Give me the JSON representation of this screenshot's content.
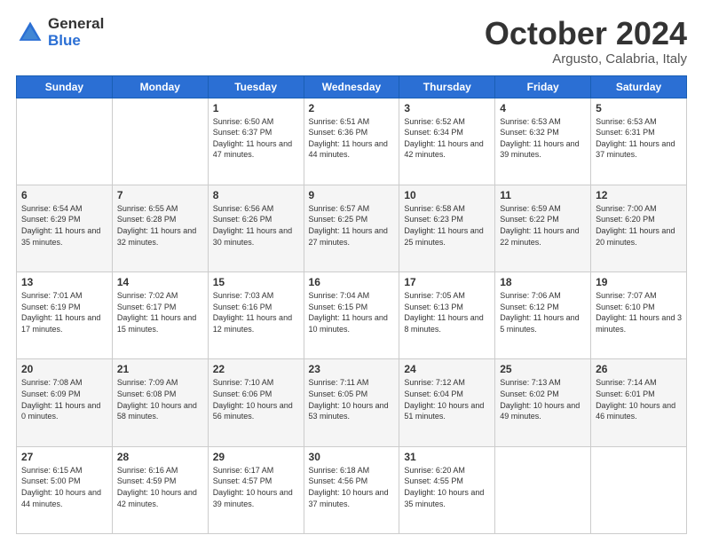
{
  "header": {
    "logo_line1": "General",
    "logo_line2": "Blue",
    "month": "October 2024",
    "location": "Argusto, Calabria, Italy"
  },
  "weekdays": [
    "Sunday",
    "Monday",
    "Tuesday",
    "Wednesday",
    "Thursday",
    "Friday",
    "Saturday"
  ],
  "rows": [
    [
      null,
      null,
      {
        "day": "1",
        "sunrise": "6:50 AM",
        "sunset": "6:37 PM",
        "daylight": "11 hours and 47 minutes."
      },
      {
        "day": "2",
        "sunrise": "6:51 AM",
        "sunset": "6:36 PM",
        "daylight": "11 hours and 44 minutes."
      },
      {
        "day": "3",
        "sunrise": "6:52 AM",
        "sunset": "6:34 PM",
        "daylight": "11 hours and 42 minutes."
      },
      {
        "day": "4",
        "sunrise": "6:53 AM",
        "sunset": "6:32 PM",
        "daylight": "11 hours and 39 minutes."
      },
      {
        "day": "5",
        "sunrise": "6:53 AM",
        "sunset": "6:31 PM",
        "daylight": "11 hours and 37 minutes."
      }
    ],
    [
      {
        "day": "6",
        "sunrise": "6:54 AM",
        "sunset": "6:29 PM",
        "daylight": "11 hours and 35 minutes."
      },
      {
        "day": "7",
        "sunrise": "6:55 AM",
        "sunset": "6:28 PM",
        "daylight": "11 hours and 32 minutes."
      },
      {
        "day": "8",
        "sunrise": "6:56 AM",
        "sunset": "6:26 PM",
        "daylight": "11 hours and 30 minutes."
      },
      {
        "day": "9",
        "sunrise": "6:57 AM",
        "sunset": "6:25 PM",
        "daylight": "11 hours and 27 minutes."
      },
      {
        "day": "10",
        "sunrise": "6:58 AM",
        "sunset": "6:23 PM",
        "daylight": "11 hours and 25 minutes."
      },
      {
        "day": "11",
        "sunrise": "6:59 AM",
        "sunset": "6:22 PM",
        "daylight": "11 hours and 22 minutes."
      },
      {
        "day": "12",
        "sunrise": "7:00 AM",
        "sunset": "6:20 PM",
        "daylight": "11 hours and 20 minutes."
      }
    ],
    [
      {
        "day": "13",
        "sunrise": "7:01 AM",
        "sunset": "6:19 PM",
        "daylight": "11 hours and 17 minutes."
      },
      {
        "day": "14",
        "sunrise": "7:02 AM",
        "sunset": "6:17 PM",
        "daylight": "11 hours and 15 minutes."
      },
      {
        "day": "15",
        "sunrise": "7:03 AM",
        "sunset": "6:16 PM",
        "daylight": "11 hours and 12 minutes."
      },
      {
        "day": "16",
        "sunrise": "7:04 AM",
        "sunset": "6:15 PM",
        "daylight": "11 hours and 10 minutes."
      },
      {
        "day": "17",
        "sunrise": "7:05 AM",
        "sunset": "6:13 PM",
        "daylight": "11 hours and 8 minutes."
      },
      {
        "day": "18",
        "sunrise": "7:06 AM",
        "sunset": "6:12 PM",
        "daylight": "11 hours and 5 minutes."
      },
      {
        "day": "19",
        "sunrise": "7:07 AM",
        "sunset": "6:10 PM",
        "daylight": "11 hours and 3 minutes."
      }
    ],
    [
      {
        "day": "20",
        "sunrise": "7:08 AM",
        "sunset": "6:09 PM",
        "daylight": "11 hours and 0 minutes."
      },
      {
        "day": "21",
        "sunrise": "7:09 AM",
        "sunset": "6:08 PM",
        "daylight": "10 hours and 58 minutes."
      },
      {
        "day": "22",
        "sunrise": "7:10 AM",
        "sunset": "6:06 PM",
        "daylight": "10 hours and 56 minutes."
      },
      {
        "day": "23",
        "sunrise": "7:11 AM",
        "sunset": "6:05 PM",
        "daylight": "10 hours and 53 minutes."
      },
      {
        "day": "24",
        "sunrise": "7:12 AM",
        "sunset": "6:04 PM",
        "daylight": "10 hours and 51 minutes."
      },
      {
        "day": "25",
        "sunrise": "7:13 AM",
        "sunset": "6:02 PM",
        "daylight": "10 hours and 49 minutes."
      },
      {
        "day": "26",
        "sunrise": "7:14 AM",
        "sunset": "6:01 PM",
        "daylight": "10 hours and 46 minutes."
      }
    ],
    [
      {
        "day": "27",
        "sunrise": "6:15 AM",
        "sunset": "5:00 PM",
        "daylight": "10 hours and 44 minutes."
      },
      {
        "day": "28",
        "sunrise": "6:16 AM",
        "sunset": "4:59 PM",
        "daylight": "10 hours and 42 minutes."
      },
      {
        "day": "29",
        "sunrise": "6:17 AM",
        "sunset": "4:57 PM",
        "daylight": "10 hours and 39 minutes."
      },
      {
        "day": "30",
        "sunrise": "6:18 AM",
        "sunset": "4:56 PM",
        "daylight": "10 hours and 37 minutes."
      },
      {
        "day": "31",
        "sunrise": "6:20 AM",
        "sunset": "4:55 PM",
        "daylight": "10 hours and 35 minutes."
      },
      null,
      null
    ]
  ]
}
